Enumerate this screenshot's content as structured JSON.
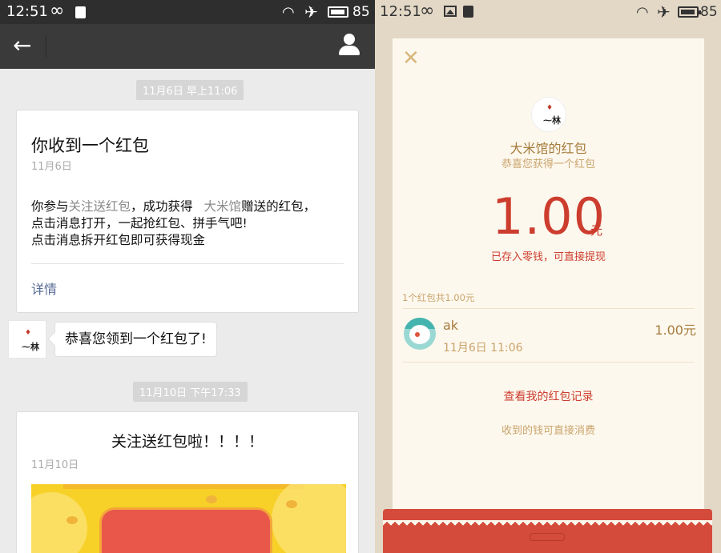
{
  "left": {
    "status": {
      "time": "12:51",
      "battery": "85"
    },
    "timestamp1": "11月6日 早上11:06",
    "card1": {
      "title": "你收到一个红包",
      "date": "11月6日",
      "line1_a": "你参与",
      "line1_link": "关注送红包",
      "line1_b": "，成功获得",
      "line1_sender": "大米馆",
      "line1_c": "赠送的红包，",
      "line2": "点击消息打开，一起抢红包、拼手气吧!",
      "line3": "点击消息拆开红包即可获得现金",
      "detail": "详情"
    },
    "bubble": "恭喜您领到一个红包了!",
    "timestamp2": "11月10日 下午17:33",
    "card2": {
      "title": "关注送红包啦！！！！",
      "date": "11月10日"
    }
  },
  "right": {
    "status": {
      "time": "12:51",
      "battery": "85"
    },
    "sender": "大米馆的红包",
    "wish": "恭喜您获得一个红包",
    "amount": "1.00",
    "unit": "元",
    "stored": "已存入零钱，可直接提现",
    "total": "1个红包共1.00元",
    "receiver": {
      "name": "ak",
      "time": "11月6日  11:06",
      "amount": "1.00元"
    },
    "records": "查看我的红包记录",
    "spend": "收到的钱可直接消费"
  },
  "colors": {
    "red": "#cc3d2e",
    "gold": "#a67c3c",
    "sheet": "#fdf8ee",
    "wechat_link": "#576b95"
  }
}
